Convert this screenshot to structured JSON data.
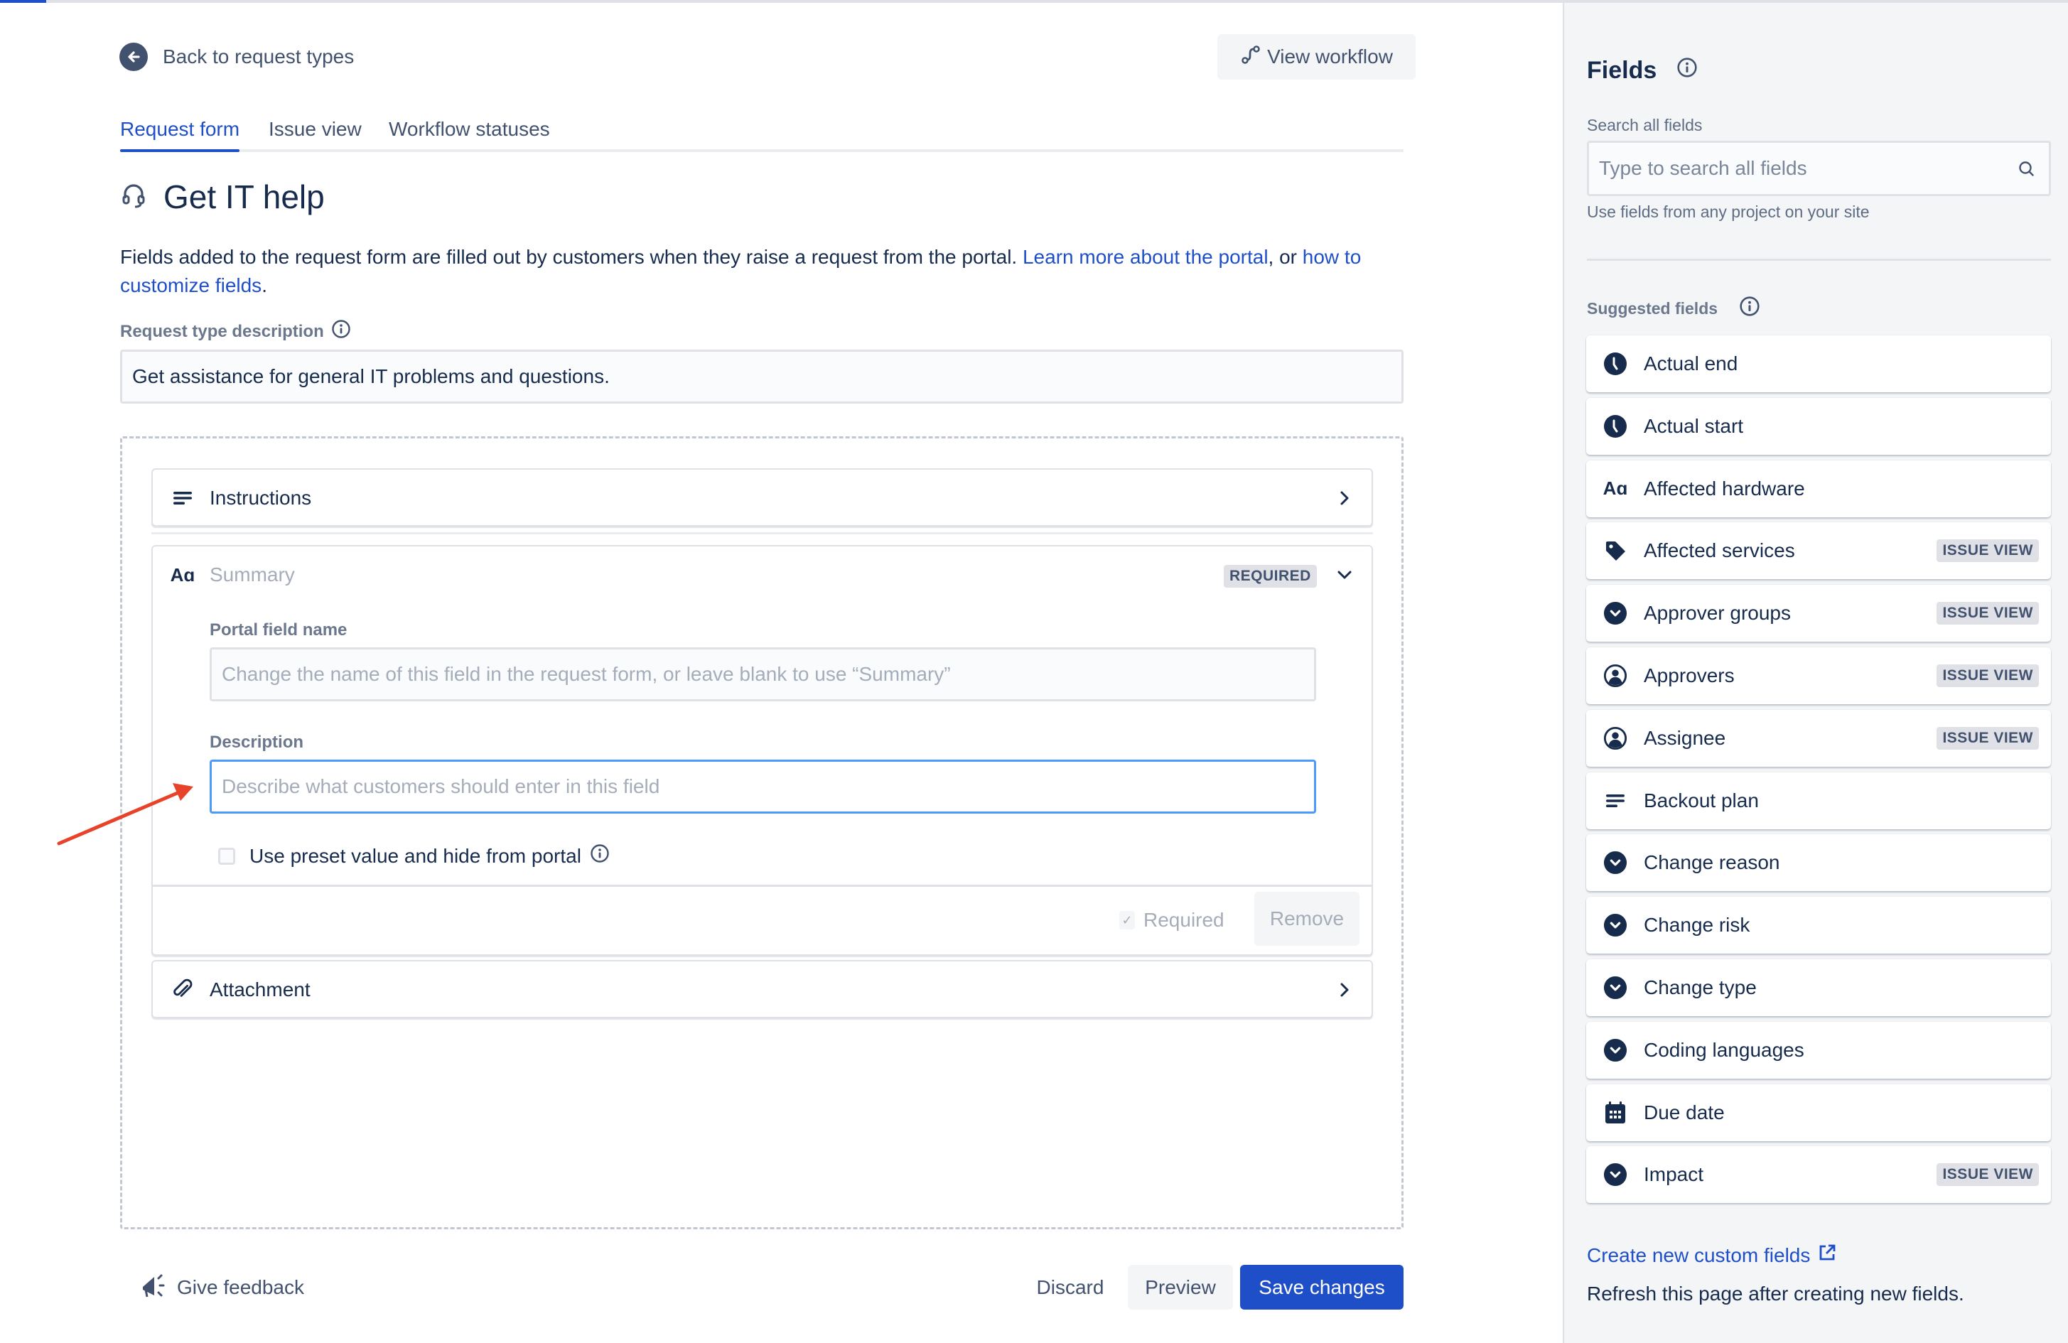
{
  "colors": {
    "accent": "#1F4FC8",
    "text": "#172B4D",
    "subtle": "#42526E",
    "panel_bg": "#F4F5F7",
    "annotation_arrow": "#E8432A",
    "focus_border": "#4C9AFF"
  },
  "header": {
    "back_label": "Back to request types",
    "view_workflow_label": "View workflow"
  },
  "tabs": [
    {
      "label": "Request form",
      "active": true
    },
    {
      "label": "Issue view",
      "active": false
    },
    {
      "label": "Workflow statuses",
      "active": false
    }
  ],
  "page": {
    "title": "Get IT help",
    "title_icon": "headset-icon",
    "intro_text": "Fields added to the request form are filled out by customers when they raise a request from the portal. ",
    "intro_link1": "Learn more about the portal",
    "intro_mid": ", or ",
    "intro_link2": "how to customize fields",
    "intro_end": "."
  },
  "request_type_description": {
    "label": "Request type description",
    "value": "Get assistance for general IT problems and questions."
  },
  "form_fields": {
    "instructions": {
      "label": "Instructions",
      "icon": "text-lines-icon"
    },
    "summary": {
      "label": "Summary",
      "icon": "text-aa-icon",
      "badge": "REQUIRED",
      "portal_field_name_label": "Portal field name",
      "portal_field_name_placeholder": "Change the name of this field in the request form, or leave blank to use “Summary”",
      "description_label": "Description",
      "description_placeholder": "Describe what customers should enter in this field",
      "preset_checkbox_label": "Use preset value and hide from portal",
      "preset_checked": false,
      "required_label": "Required",
      "required_checked": true,
      "remove_label": "Remove"
    },
    "attachment": {
      "label": "Attachment",
      "icon": "paperclip-icon"
    }
  },
  "footer": {
    "feedback_label": "Give feedback",
    "discard_label": "Discard",
    "preview_label": "Preview",
    "save_label": "Save changes"
  },
  "panel": {
    "title": "Fields",
    "search_label": "Search all fields",
    "search_placeholder": "Type to search all fields",
    "search_help": "Use fields from any project on your site",
    "suggested_label": "Suggested fields",
    "fields": [
      {
        "label": "Actual end",
        "icon": "clock",
        "badge": ""
      },
      {
        "label": "Actual start",
        "icon": "clock",
        "badge": ""
      },
      {
        "label": "Affected hardware",
        "icon": "text-aa",
        "badge": ""
      },
      {
        "label": "Affected services",
        "icon": "tag",
        "badge": "ISSUE VIEW"
      },
      {
        "label": "Approver groups",
        "icon": "dropdown",
        "badge": "ISSUE VIEW"
      },
      {
        "label": "Approvers",
        "icon": "person",
        "badge": "ISSUE VIEW"
      },
      {
        "label": "Assignee",
        "icon": "person",
        "badge": "ISSUE VIEW"
      },
      {
        "label": "Backout plan",
        "icon": "text-lines",
        "badge": ""
      },
      {
        "label": "Change reason",
        "icon": "dropdown",
        "badge": ""
      },
      {
        "label": "Change risk",
        "icon": "dropdown",
        "badge": ""
      },
      {
        "label": "Change type",
        "icon": "dropdown",
        "badge": ""
      },
      {
        "label": "Coding languages",
        "icon": "dropdown",
        "badge": ""
      },
      {
        "label": "Due date",
        "icon": "calendar",
        "badge": ""
      },
      {
        "label": "Impact",
        "icon": "dropdown",
        "badge": "ISSUE VIEW"
      }
    ],
    "create_link": "Create new custom fields",
    "refresh_text": "Refresh this page after creating new fields."
  }
}
